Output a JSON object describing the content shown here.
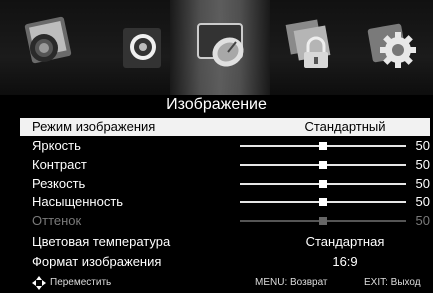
{
  "menu_title": "Изображение",
  "tabs": [
    {
      "name": "picture-tab"
    },
    {
      "name": "sound-tab"
    },
    {
      "name": "channel-tab"
    },
    {
      "name": "lock-tab"
    },
    {
      "name": "setup-tab"
    }
  ],
  "rows": {
    "mode": {
      "label": "Режим изображения",
      "value": "Стандартный"
    },
    "brightness": {
      "label": "Яркость",
      "value": "50",
      "level": 0.5
    },
    "contrast": {
      "label": "Контраст",
      "value": "50",
      "level": 0.5
    },
    "sharpness": {
      "label": "Резкость",
      "value": "50",
      "level": 0.5
    },
    "saturation": {
      "label": "Насыщенность",
      "value": "50",
      "level": 0.5
    },
    "hue": {
      "label": "Оттенок",
      "value": "50",
      "level": 0.5
    },
    "color_temp": {
      "label": "Цветовая температура",
      "value": "Стандартная"
    },
    "aspect": {
      "label": "Формат изображения",
      "value": "16:9"
    }
  },
  "footer": {
    "move_label": "Переместить",
    "menu_hint": "MENU: Возврат",
    "exit_hint": "EXIT: Выход"
  },
  "colors": {
    "selected_row_bg": "#f2f2f2",
    "disabled_text": "#7a7a7a"
  }
}
